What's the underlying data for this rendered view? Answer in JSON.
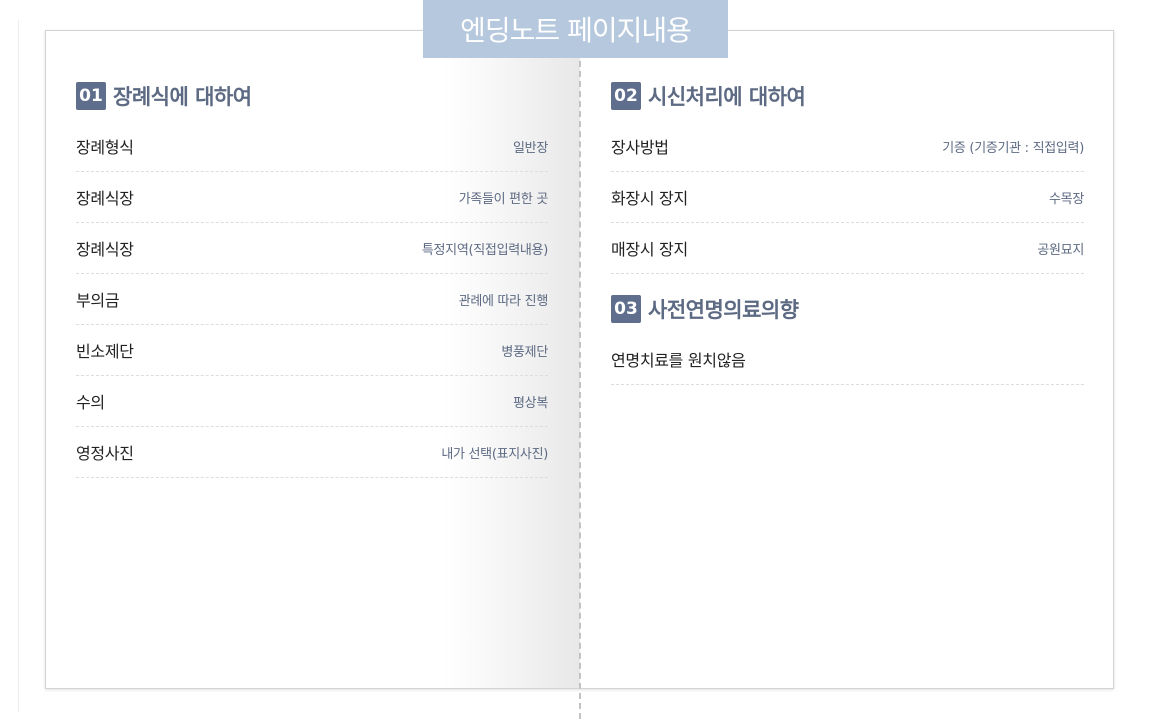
{
  "header": {
    "title": "엔딩노트 페이지내용"
  },
  "sections": [
    {
      "number": "01",
      "title": "장례식에 대하여",
      "rows": [
        {
          "label": "장례형식",
          "value": "일반장"
        },
        {
          "label": "장례식장",
          "value": "가족들이 편한 곳"
        },
        {
          "label": "장례식장",
          "value": "특정지역(직접입력내용)"
        },
        {
          "label": "부의금",
          "value": "관례에 따라 진행"
        },
        {
          "label": "빈소제단",
          "value": "병풍제단"
        },
        {
          "label": "수의",
          "value": "평상복"
        },
        {
          "label": "영정사진",
          "value": "내가 선택(표지사진)"
        }
      ]
    },
    {
      "number": "02",
      "title": "시신처리에 대하여",
      "rows": [
        {
          "label": "장사방법",
          "value": "기증 (기증기관 : 직접입력)"
        },
        {
          "label": "화장시 장지",
          "value": "수목장"
        },
        {
          "label": "매장시 장지",
          "value": "공원묘지"
        }
      ]
    },
    {
      "number": "03",
      "title": "사전연명의료의향",
      "rows": [
        {
          "label": "연명치료를 원치않음",
          "value": ""
        }
      ]
    }
  ]
}
